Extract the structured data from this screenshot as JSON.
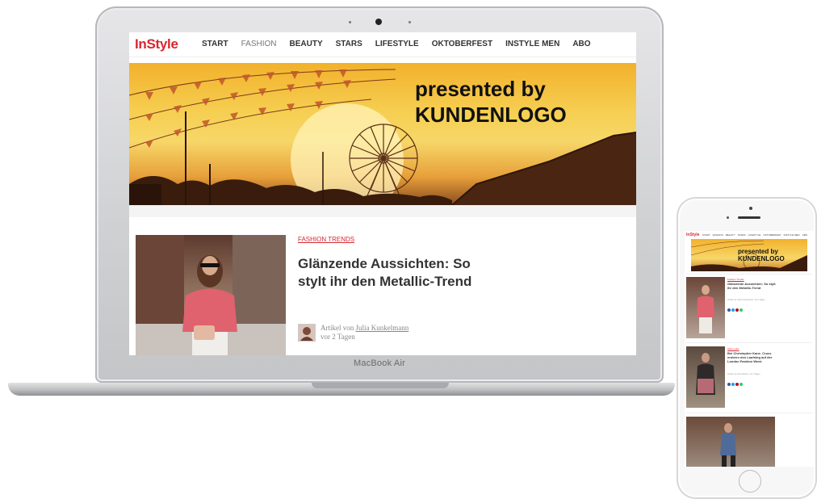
{
  "laptop": {
    "brand_label": "MacBook Air",
    "site": {
      "logo": "InStyle",
      "nav": [
        "START",
        "FASHION",
        "BEAUTY",
        "STARS",
        "LIFESTYLE",
        "OKTOBERFEST",
        "INSTYLE MEN",
        "ABO"
      ],
      "active_nav": "FASHION",
      "hero": {
        "line1": "presented by",
        "line2": "KUNDENLOGO"
      },
      "article": {
        "category": "FASHION TRENDS",
        "headline": "Glänzende Aussichten: So stylt ihr den Metallic-Trend",
        "author_prefix": "Artikel von",
        "author_name": "Julia Kunkelmann",
        "age": "vor 2 Tagen"
      }
    }
  },
  "phone": {
    "site": {
      "logo": "InStyle",
      "nav": [
        "START",
        "FASHION",
        "BEAUTY",
        "STARS",
        "LIFESTYLE",
        "OKTOBERFEST",
        "INSTYLE MEN",
        "ABO"
      ],
      "hero": {
        "line1": "presented by",
        "line2": "KUNDENLOGO"
      },
      "articles": [
        {
          "category": "Fashion Trends",
          "headline": "Glänzende Aussichten: So stylt ihr den Metallic-Trend",
          "meta": "Artikel von Julia Kunkelmann, vor 2 Tagen"
        },
        {
          "category": "Star-Looks",
          "headline": "Bei Christopher Kane. Crocs erobern den Laufsteg auf der London Fashion Week",
          "meta": "Artikel von Anna Rosen, vor 2 Tagen"
        }
      ]
    }
  },
  "colors": {
    "brand_red": "#d8262f",
    "hero_gold": "#f6cf52",
    "laptop_silver": "#cfd0d2"
  }
}
